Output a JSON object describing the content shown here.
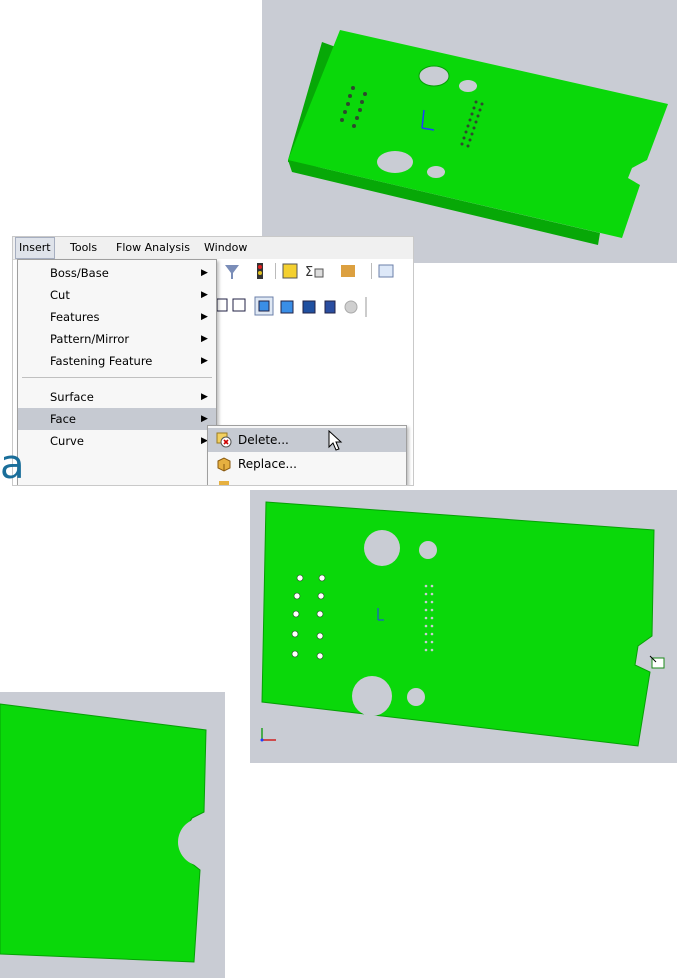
{
  "colors": {
    "viewport_bg": "#c9ccd4",
    "plate_green": "#0ad80a",
    "plate_edge": "#07a807",
    "menu_highlight": "#c6cad2"
  },
  "menu_bar": {
    "items": [
      "Insert",
      "Tools",
      "Flow Analysis",
      "Window"
    ]
  },
  "insert_menu": {
    "items": [
      {
        "label": "Boss/Base",
        "has_submenu": true
      },
      {
        "label": "Cut",
        "has_submenu": true
      },
      {
        "label": "Features",
        "has_submenu": true
      },
      {
        "label": "Pattern/Mirror",
        "has_submenu": true
      },
      {
        "label": "Fastening Feature",
        "has_submenu": true
      },
      {
        "label": "Surface",
        "has_submenu": true
      },
      {
        "label": "Face",
        "has_submenu": true,
        "highlighted": true
      },
      {
        "label": "Curve",
        "has_submenu": true
      }
    ]
  },
  "face_submenu": {
    "items": [
      {
        "label": "Delete...",
        "icon": "delete-face-icon",
        "highlighted": true
      },
      {
        "label": "Replace...",
        "icon": "replace-face-icon"
      }
    ]
  },
  "overlay_glyph": "a",
  "icons": [
    "filter-icon",
    "traffic-light-icon",
    "grid-icon",
    "sigma-icon",
    "display-icon",
    "view-cube-icon",
    "mouse-pointer-icon",
    "triad-icon"
  ]
}
